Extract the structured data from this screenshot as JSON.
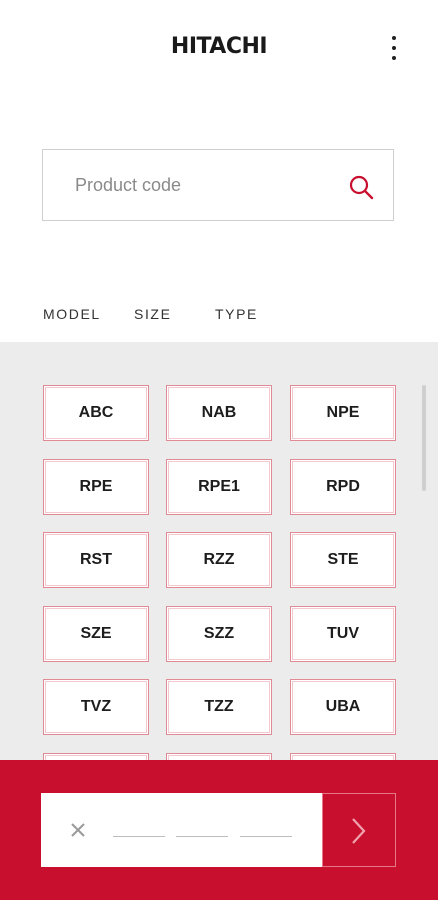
{
  "header": {
    "logo_text": "HITACHI",
    "menu_icon": "kebab-menu-icon"
  },
  "search": {
    "placeholder": "Product code",
    "value": "",
    "icon": "search-icon"
  },
  "tabs": [
    {
      "label": "MODEL",
      "active": false
    },
    {
      "label": "SIZE",
      "active": false
    },
    {
      "label": "TYPE",
      "active": true
    }
  ],
  "type_grid": {
    "items": [
      "ABC",
      "NAB",
      "NPE",
      "RPE",
      "RPE1",
      "RPD",
      "RST",
      "RZZ",
      "STE",
      "SZE",
      "SZZ",
      "TUV",
      "TVZ",
      "TZZ",
      "UBA"
    ]
  },
  "code_entry": {
    "clear_icon": "close-icon",
    "slots": [
      "",
      "",
      ""
    ],
    "submit_icon": "chevron-right-icon"
  },
  "colors": {
    "accent": "#c8102e",
    "grid_background": "#ececec",
    "button_border": "#e08a95"
  }
}
